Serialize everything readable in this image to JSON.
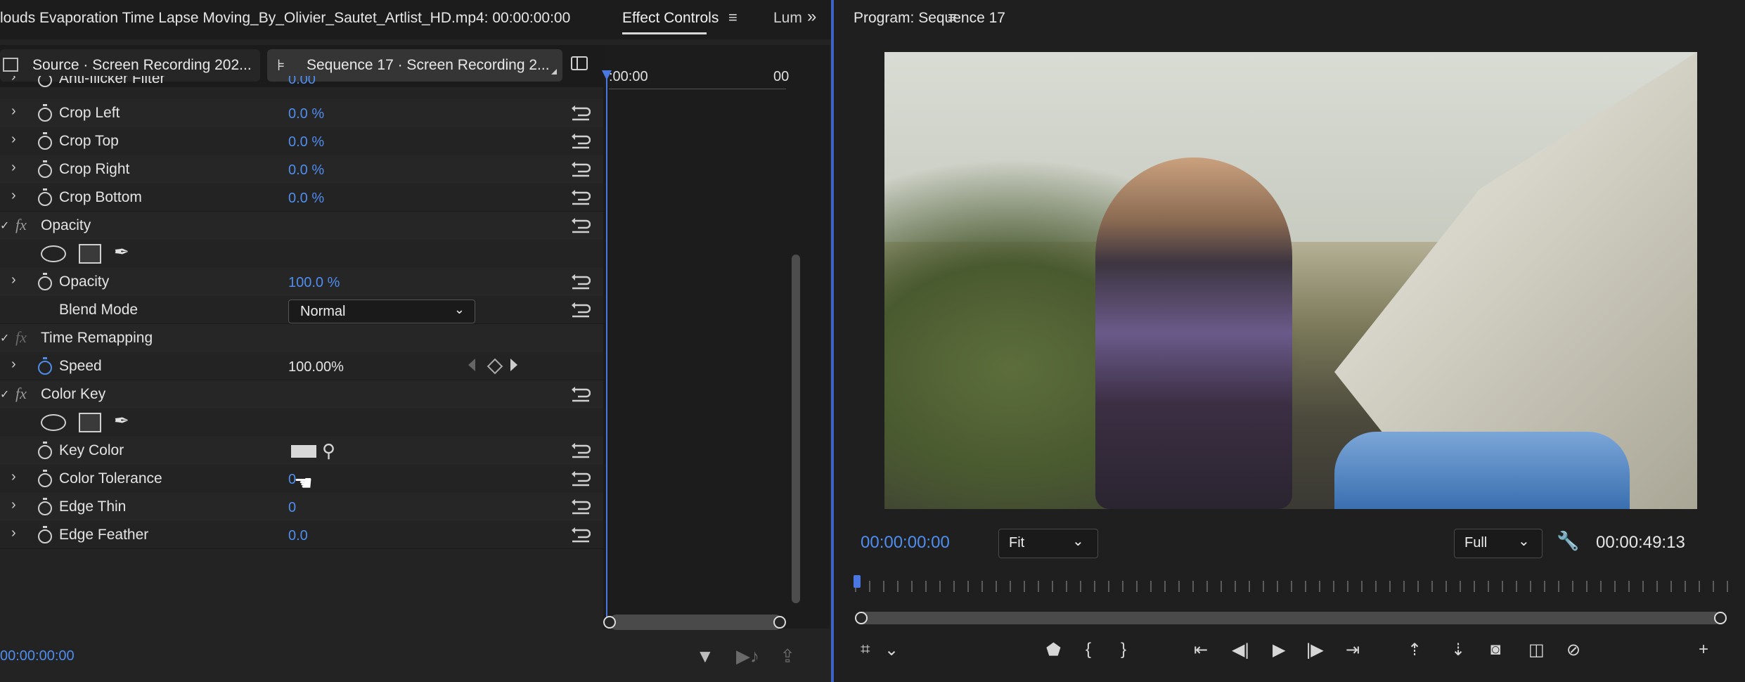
{
  "header": {
    "clip_title": "louds Evaporation Time Lapse Moving_By_Olivier_Sautet_Artlist_HD.mp4: 00:00:00:00",
    "active_tab": "Effect Controls",
    "next_tab": "Lum",
    "menu_glyph": "≡",
    "more_glyph": "»"
  },
  "source_tabs": {
    "source": "Source · Screen Recording 202...",
    "sequence": "Sequence 17 · Screen Recording 2..."
  },
  "timeline": {
    "tick_start": ":00:00",
    "tick_end": "00"
  },
  "effects": {
    "partial_row": {
      "label": "Anti-flicker Filter",
      "value": "0.00"
    },
    "crop_left": {
      "label": "Crop Left",
      "value": "0.0 %"
    },
    "crop_top": {
      "label": "Crop Top",
      "value": "0.0 %"
    },
    "crop_right": {
      "label": "Crop Right",
      "value": "0.0 %"
    },
    "crop_bottom": {
      "label": "Crop Bottom",
      "value": "0.0 %"
    },
    "opacity_group": {
      "label": "Opacity"
    },
    "opacity": {
      "label": "Opacity",
      "value": "100.0 %"
    },
    "blend_mode": {
      "label": "Blend Mode",
      "value": "Normal"
    },
    "time_remap_group": {
      "label": "Time Remapping"
    },
    "speed": {
      "label": "Speed",
      "value": "100.00%"
    },
    "color_key_group": {
      "label": "Color Key"
    },
    "key_color": {
      "label": "Key Color"
    },
    "color_tolerance": {
      "label": "Color Tolerance",
      "value": "0"
    },
    "edge_thin": {
      "label": "Edge Thin",
      "value": "0"
    },
    "edge_feather": {
      "label": "Edge Feather",
      "value": "0.0"
    }
  },
  "footer": {
    "timecode": "00:00:00:00"
  },
  "program": {
    "title": "Program: Sequence 17",
    "menu_glyph": "≡",
    "timecode_current": "00:00:00:00",
    "fit_label": "Fit",
    "quality_label": "Full",
    "duration": "00:00:49:13"
  },
  "colors": {
    "accent": "#4f8ef0",
    "divider": "#3f62c6",
    "panel_bg": "#232323"
  },
  "icons": [
    "stopwatch-icon",
    "reset-icon",
    "chevron-right-icon",
    "fx-icon",
    "ellipse-mask-icon",
    "rectangle-mask-icon",
    "pen-mask-icon",
    "eyedropper-icon",
    "filter-icon",
    "wrench-icon",
    "play-icon",
    "marker-icon",
    "camera-icon"
  ]
}
